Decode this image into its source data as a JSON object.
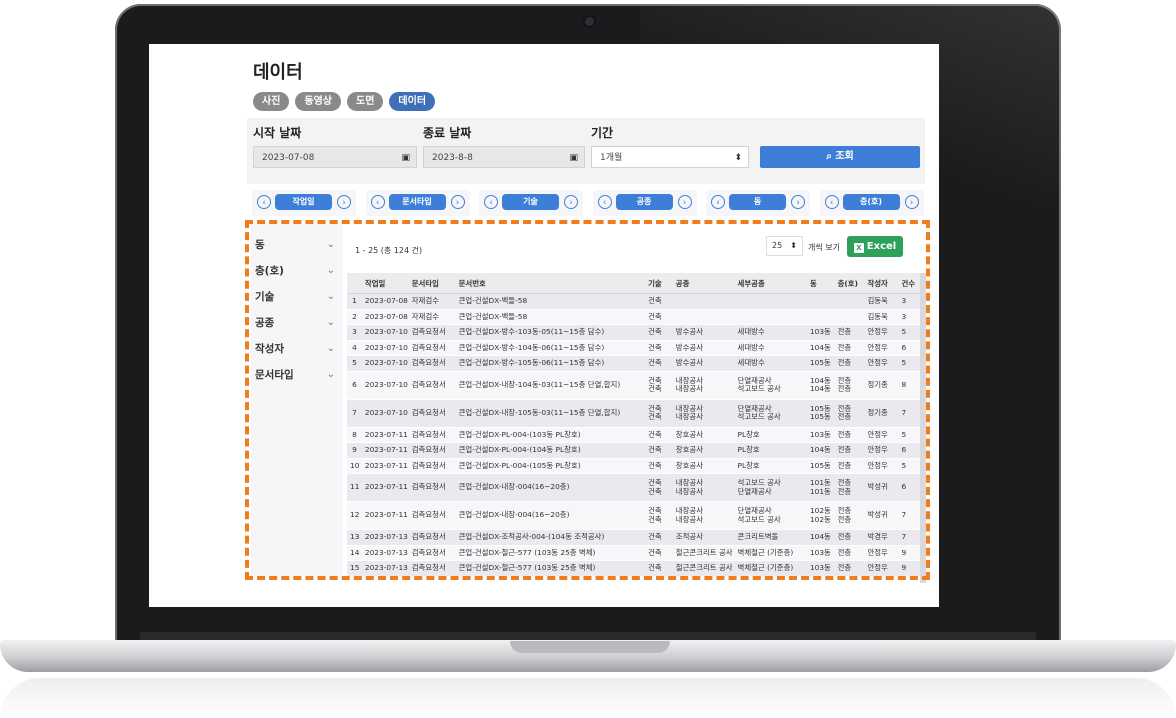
{
  "page": {
    "title": "데이터",
    "tabs": [
      {
        "label": "사진",
        "active": false
      },
      {
        "label": "동영상",
        "active": false
      },
      {
        "label": "도면",
        "active": false
      },
      {
        "label": "데이터",
        "active": true
      }
    ]
  },
  "filters": {
    "start_label": "시작 날짜",
    "start_value": "2023-07-08",
    "end_label": "종료 날짜",
    "end_value": "2023-8-8",
    "period_label": "기간",
    "period_value": "1개월",
    "search_label": "조회"
  },
  "sorters": [
    "작업일",
    "문서타입",
    "기술",
    "공종",
    "동",
    "층(호)"
  ],
  "sidebar": {
    "items": [
      "동",
      "층(호)",
      "기술",
      "공종",
      "작성자",
      "문서타입"
    ]
  },
  "table_meta": {
    "count_text": "1 - 25 (총 124 건)",
    "page_size": "25",
    "page_size_suffix": "개씩 보기",
    "excel_label": "Excel"
  },
  "columns": [
    "",
    "작업일",
    "문서타입",
    "문서번호",
    "기술",
    "공종",
    "세부공종",
    "동",
    "층(호)",
    "작성자",
    "건수"
  ],
  "rows": [
    [
      "1",
      "2023-07-08",
      "자재검수",
      "큰업-건설DX-백들-58",
      "건축",
      "",
      "",
      "",
      "",
      "김동욱",
      "3"
    ],
    [
      "2",
      "2023-07-08",
      "자재검수",
      "큰업-건설DX-백들-58",
      "건축",
      "",
      "",
      "",
      "",
      "김동욱",
      "3"
    ],
    [
      "3",
      "2023-07-10",
      "검측요청서",
      "큰업-건설DX-방수-103동-05(11~15층 담수)",
      "건축",
      "방수공사",
      "세대방수",
      "103동",
      "전층",
      "안정우",
      "5"
    ],
    [
      "4",
      "2023-07-10",
      "검측요청서",
      "큰업-건설DX-방수-104동-06(11~15층 담수)",
      "건축",
      "방수공사",
      "세대방수",
      "104동",
      "전층",
      "안정우",
      "6"
    ],
    [
      "5",
      "2023-07-10",
      "검측요청서",
      "큰업-건설DX-방수-105동-06(11~15층 담수)",
      "건축",
      "방수공사",
      "세대방수",
      "105동",
      "전층",
      "안정우",
      "5"
    ],
    [
      "6",
      "2023-07-10",
      "검측요청서",
      "큰업-건설DX-내장-104동-03(11~15층 단열,합지)",
      "건축\n건축",
      "내장공사\n내장공사",
      "단열재공사\n석고보드 공사",
      "104동\n104동",
      "전층\n전층",
      "정기종",
      "8"
    ],
    [
      "7",
      "2023-07-10",
      "검측요청서",
      "큰업-건설DX-내장-105동-03(11~15층 단열,합지)",
      "건축\n건축",
      "내장공사\n내장공사",
      "단열재공사\n석고보드 공사",
      "105동\n105동",
      "전층\n전층",
      "정기종",
      "7"
    ],
    [
      "8",
      "2023-07-11",
      "검측요청서",
      "큰업-건설DX-PL-004-(103동 PL창호)",
      "건축",
      "창호공사",
      "PL창호",
      "103동",
      "전층",
      "안정우",
      "5"
    ],
    [
      "9",
      "2023-07-11",
      "검측요청서",
      "큰업-건설DX-PL-004-(104동 PL창호)",
      "건축",
      "창호공사",
      "PL창호",
      "104동",
      "전층",
      "안정우",
      "6"
    ],
    [
      "10",
      "2023-07-11",
      "검측요청서",
      "큰업-건설DX-PL-004-(105동 PL창호)",
      "건축",
      "창호공사",
      "PL창호",
      "105동",
      "전층",
      "안정우",
      "5"
    ],
    [
      "11",
      "2023-07-11",
      "검측요청서",
      "큰업-건설DX-내장-004(16~20층)",
      "건축\n건축",
      "내장공사\n내장공사",
      "석고보드 공사\n단열재공사",
      "101동\n101동",
      "전층\n전층",
      "박성귀",
      "6"
    ],
    [
      "12",
      "2023-07-11",
      "검측요청서",
      "큰업-건설DX-내장-004(16~20층)",
      "건축\n건축",
      "내장공사\n내장공사",
      "단열재공사\n석고보드 공사",
      "102동\n102동",
      "전층\n전층",
      "박성귀",
      "7"
    ],
    [
      "13",
      "2023-07-13",
      "검측요청서",
      "큰업-건설DX-조적공사-004-(104동 조적공사)",
      "건축",
      "조적공사",
      "콘크리트벽돌",
      "104동",
      "전층",
      "박경우",
      "7"
    ],
    [
      "14",
      "2023-07-13",
      "검측요청서",
      "큰업-건설DX-철근-577 (103동 25층 벽체)",
      "건축",
      "철근콘크리트 공사",
      "벽체철근 (기준층)",
      "103동",
      "전층",
      "안정우",
      "9"
    ],
    [
      "15",
      "2023-07-13",
      "검측요청서",
      "큰업-건설DX-철근-577 (103동 25층 벽체)",
      "건축",
      "철근콘크리트 공사",
      "벽체철근 (기준층)",
      "103동",
      "전층",
      "안정우",
      "9"
    ]
  ],
  "colors": {
    "accent": "#3d7fd8",
    "active_tab": "#3f6fb6",
    "excel": "#2da05a",
    "highlight_frame": "#f07c1e"
  }
}
